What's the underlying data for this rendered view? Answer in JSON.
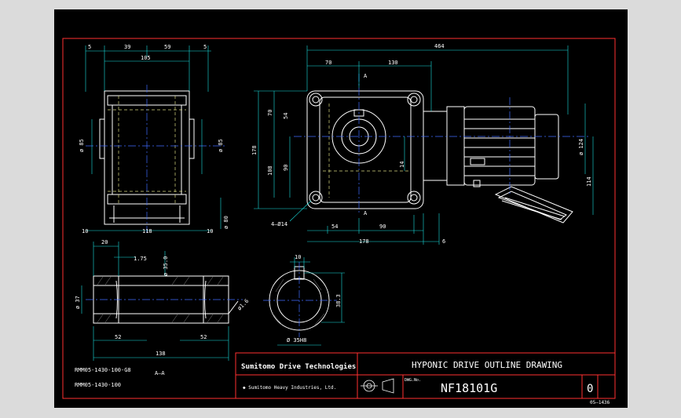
{
  "colors": {
    "background_outer": "#dbdbdb",
    "sheet": "#000000",
    "border": "#ff3030",
    "outline": "#ffffff",
    "centerline": "#3f6bff",
    "dimension": "#19e0e0",
    "dimtext": "#ffffff",
    "hidden": "#d8d880"
  },
  "dims": {
    "d5l": "5",
    "d39": "39",
    "d59": "59",
    "d5r": "5",
    "d105": "105",
    "d85l": "ø 85",
    "d85r": "ø 85",
    "d10": "10",
    "d118": "118",
    "d10r": "10",
    "d80": "ø 80",
    "d70": "70",
    "d130": "130",
    "d464": "464",
    "vA": "70",
    "v54": "54",
    "v178": "178",
    "v108": "108",
    "v90": "90",
    "v14": "14",
    "v124": "ø 124",
    "v114": "114",
    "hole": "4–Ø14",
    "h54": "54",
    "h90": "90",
    "h178": "178",
    "h6": "6",
    "sectionA_top": "A",
    "sectionA_bot": "A",
    "s20": "20",
    "s175": "1.75",
    "s359": "ø 35.0",
    "s37": "ø 37",
    "s52l": "52",
    "s52r": "52",
    "s138": "138",
    "s16": "ø1.6",
    "k10": "10",
    "k383": "38.3",
    "k35": "Ø 35H8"
  },
  "parts": {
    "part1": "RMM05-1430-100-G8",
    "part2": "RMM05-1430-100",
    "section_label": "A–A"
  },
  "title_block": {
    "brand": "Sumitomo Drive Technologies",
    "company": "◆ Sumitomo Heavy Industries, Ltd.",
    "title": "HYPONIC DRIVE OUTLINE DRAWING",
    "dwg_no_label": "DWG.No.",
    "dwg_no": "NF18101G",
    "rev": "0",
    "sheet_code": "05–1436"
  }
}
